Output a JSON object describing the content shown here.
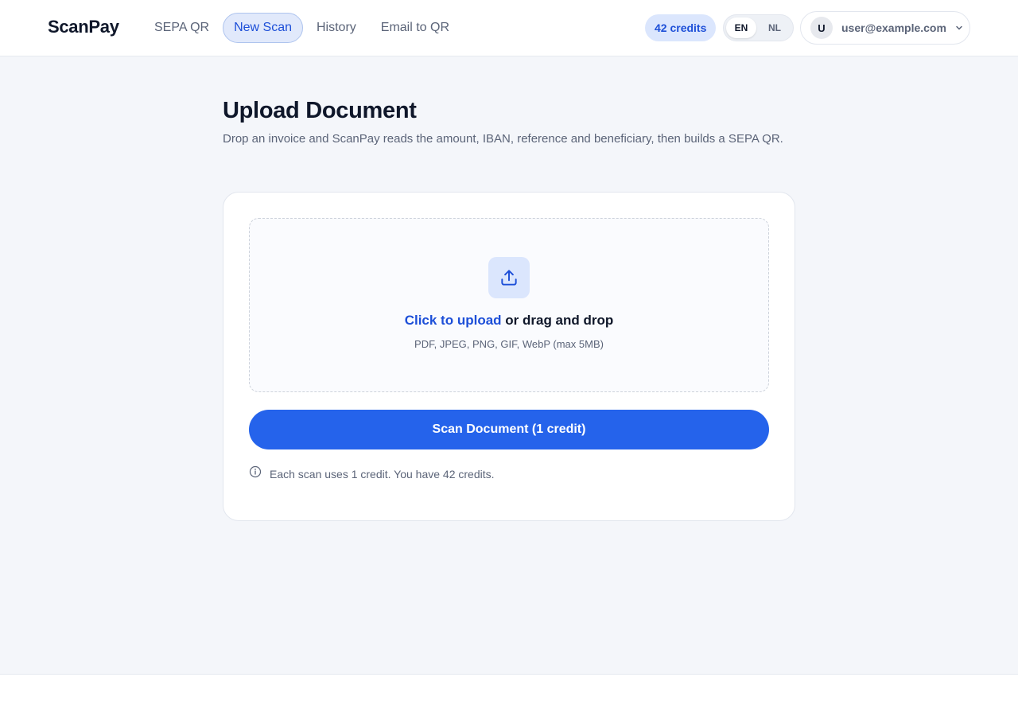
{
  "header": {
    "logo": "ScanPay",
    "nav": [
      {
        "label": "SEPA QR",
        "active": false
      },
      {
        "label": "New Scan",
        "active": true
      },
      {
        "label": "History",
        "active": false
      },
      {
        "label": "Email to QR",
        "active": false
      }
    ],
    "credits_badge": "42 credits",
    "languages": [
      {
        "label": "EN",
        "active": true
      },
      {
        "label": "NL",
        "active": false
      }
    ],
    "user": {
      "avatar_initial": "U",
      "email": "user@example.com",
      "menu_icon": "chevron-down-icon"
    }
  },
  "main": {
    "title": "Upload Document",
    "subtitle": "Drop an invoice and ScanPay reads the amount, IBAN, reference and beneficiary, then builds a SEPA QR.",
    "dropzone": {
      "icon": "upload-icon",
      "link_text": "Click to upload",
      "rest_text": " or drag and drop",
      "hint": "PDF, JPEG, PNG, GIF, WebP (max 5MB)"
    },
    "scan_button": "Scan Document (1 credit)",
    "info": {
      "icon": "info-icon",
      "text": "Each scan uses 1 credit. You have 42 credits."
    }
  },
  "colors": {
    "accent": "#2563eb",
    "accent_text": "#1d4fd8",
    "accent_light": "#dbe6fd",
    "background": "#f4f6fa",
    "muted_text": "#5b6478"
  }
}
